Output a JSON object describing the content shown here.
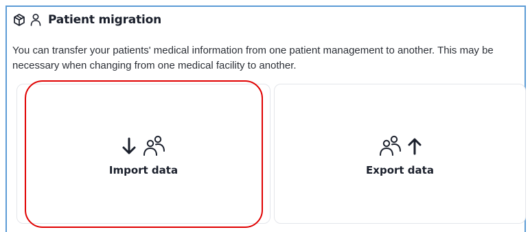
{
  "section": {
    "title": "Patient migration",
    "description": "You can transfer your patients' medical information from one patient management to another. This may be necessary when changing from one medical facility to another.",
    "icons": [
      "box-icon",
      "person-icon"
    ]
  },
  "cards": [
    {
      "label": "Import data",
      "icons": [
        "arrow-down-icon",
        "people-icon"
      ],
      "highlighted": true
    },
    {
      "label": "Export data",
      "icons": [
        "people-icon",
        "arrow-up-icon"
      ],
      "highlighted": false
    }
  ],
  "colors": {
    "text_dark": "#1a1f2b",
    "panel_border": "#5b9bd5",
    "card_border": "#e3e5ea",
    "highlight": "#e00000"
  }
}
